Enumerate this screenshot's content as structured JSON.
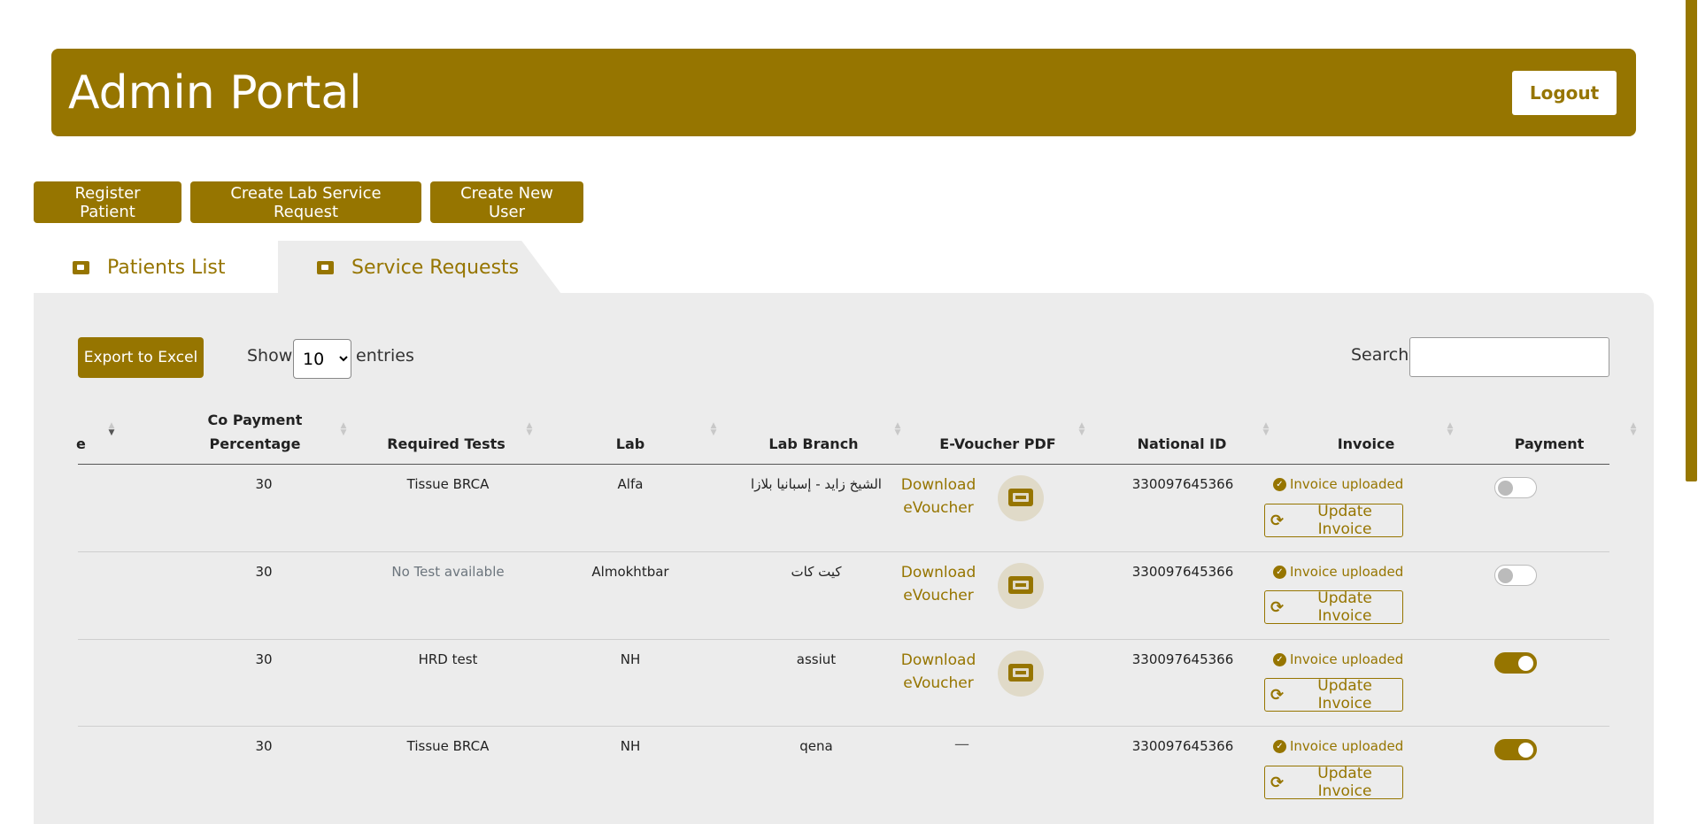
{
  "header": {
    "title": "Admin Portal",
    "logout_label": "Logout"
  },
  "actions": {
    "register": "Register Patient",
    "create_lab": "Create Lab Service Request",
    "create_user": "Create New User"
  },
  "tabs": [
    {
      "label": "Patients List",
      "icon": "id-card-icon"
    },
    {
      "label": "Service Requests",
      "icon": "ticket-icon"
    }
  ],
  "table_controls": {
    "export_label": "Export to Excel",
    "show_label": "Show",
    "entries_value": "10",
    "entries_label": "entries",
    "search_label": "Search:",
    "search_value": ""
  },
  "columns": {
    "c0": "e",
    "c1a": "Co Payment",
    "c1b": "Percentage",
    "c2": "Required Tests",
    "c3": "Lab",
    "c4": "Lab Branch",
    "c5": "E-Voucher PDF",
    "c6": "National ID",
    "c7": "Invoice",
    "c8": "Payment"
  },
  "rows": [
    {
      "copay": "30",
      "tests": "Tissue BRCA",
      "lab": "Alfa",
      "branch": "الشيخ زايد - إسبانيا بلازا",
      "voucher_line1": "Download",
      "voucher_line2": "eVoucher",
      "national_id": "330097645366",
      "invoice_status": "Invoice uploaded",
      "update_label": "Update Invoice",
      "payment": false
    },
    {
      "copay": "30",
      "tests": "No Test available",
      "lab": "Almokhtbar",
      "branch": "كيت كات",
      "voucher_line1": "Download",
      "voucher_line2": "eVoucher",
      "national_id": "330097645366",
      "invoice_status": "Invoice uploaded",
      "update_label": "Update Invoice",
      "payment": false
    },
    {
      "copay": "30",
      "tests": "HRD test",
      "lab": "NH",
      "branch": "assiut",
      "voucher_line1": "Download",
      "voucher_line2": "eVoucher",
      "national_id": "330097645366",
      "invoice_status": "Invoice uploaded",
      "update_label": "Update Invoice",
      "payment": true
    },
    {
      "copay": "30",
      "tests": "Tissue BRCA",
      "lab": "NH",
      "branch": "qena",
      "voucher_dash": "—",
      "national_id": "330097645366",
      "invoice_status": "Invoice uploaded",
      "update_label": "Update Invoice",
      "payment": true
    }
  ],
  "colors": {
    "brand": "#967500",
    "panel": "#ececec"
  }
}
